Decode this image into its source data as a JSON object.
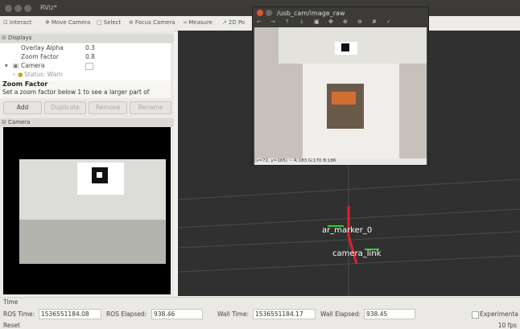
{
  "window": {
    "title": "RViz*"
  },
  "toolbar": {
    "items": [
      "Interact",
      "Move Camera",
      "Select",
      "Focus Camera",
      "Measure",
      "2D Po"
    ]
  },
  "displays_panel": {
    "title": "Displays",
    "rows": [
      {
        "key": "Overlay Alpha",
        "value": "0.3"
      },
      {
        "key": "Zoom Factor",
        "value": "0.8"
      },
      {
        "key": "Camera",
        "value": ""
      },
      {
        "key": "Status: Warn",
        "value": ""
      }
    ],
    "desc_title": "Zoom Factor",
    "desc_text": "Set a zoom factor below 1 to see a larger part of",
    "buttons": [
      "Add",
      "Duplicate",
      "Remove",
      "Rename"
    ]
  },
  "camera_panel": {
    "title": "Camera"
  },
  "image_window": {
    "title": "/usb_cam/image_raw",
    "status": "(x=72, y=165) ~ R:183 G:170 B:186"
  },
  "scene": {
    "labels": [
      "ar_marker_0",
      "camera_link"
    ]
  },
  "time_panel": {
    "title": "Time",
    "ros_time_label": "ROS Time:",
    "ros_time": "1536551184.08",
    "ros_elapsed_label": "ROS Elapsed:",
    "ros_elapsed": "938.46",
    "wall_time_label": "Wall Time:",
    "wall_time": "1536551184.17",
    "wall_elapsed_label": "Wall Elapsed:",
    "wall_elapsed": "938.45",
    "experimental_label": "Experimenta"
  },
  "statusbar": {
    "reset": "Reset",
    "fps": "10 fps"
  },
  "colors": {
    "grid_bg": "#303030",
    "axis_red": "#e0202a",
    "axis_green": "#2bd12b"
  }
}
